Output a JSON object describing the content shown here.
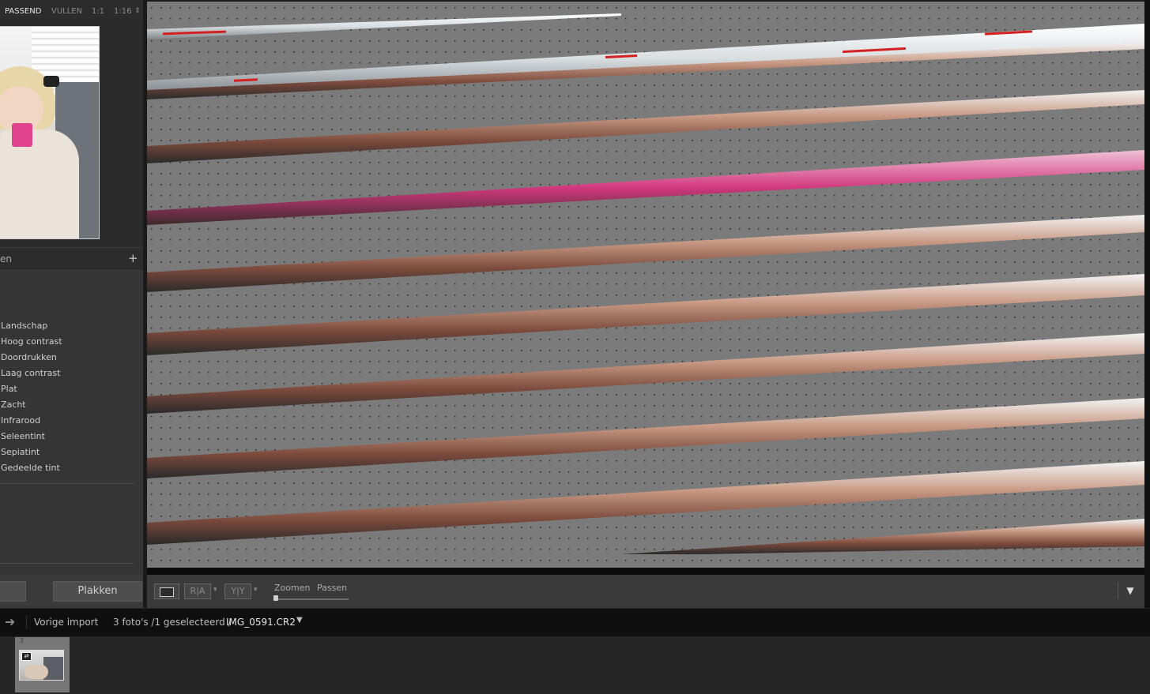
{
  "navigator": {
    "modes": [
      {
        "label": "PASSEND",
        "active": true
      },
      {
        "label": "VULLEN",
        "active": false
      },
      {
        "label": "1:1",
        "active": false
      },
      {
        "label": "1:16",
        "active": false
      }
    ],
    "mode_dropdown_icon": "updown-arrows-icon"
  },
  "presets": {
    "title_partial": "en",
    "add_icon": "plus-icon",
    "items": [
      "Landschap",
      "Hoog contrast",
      "Doordrukken",
      "Laag contrast",
      "Plat",
      "Zacht",
      "Infrarood",
      "Seleentint",
      "Sepiatint",
      "Gedeelde tint"
    ]
  },
  "buttons": {
    "copy_label": "",
    "paste_label": "Plakken"
  },
  "toolbar": {
    "view_mode_icon": "loupe-view-icon",
    "ra_label": "R|A",
    "yy_label": "Y|Y",
    "zoom_label": "Zoomen",
    "fit_label": "Passen",
    "zoom_level": 0,
    "menu_icon": "chevron-down-icon"
  },
  "filmstrip_bar": {
    "nav_icon": "arrow-right-icon",
    "source": "Vorige import",
    "count": "3 foto's /1 geselecteerd /",
    "filename": "IMG_0591.CR2",
    "dropdown_icon": "caret-down-icon"
  },
  "filmstrip": {
    "index": "3",
    "badge_icon": "virtual-copy-icon"
  },
  "colors": {
    "panel_bg": "#3a3a3a",
    "canvas_bg": "#7b7b7b",
    "filmstrip_selected": "#777777"
  }
}
